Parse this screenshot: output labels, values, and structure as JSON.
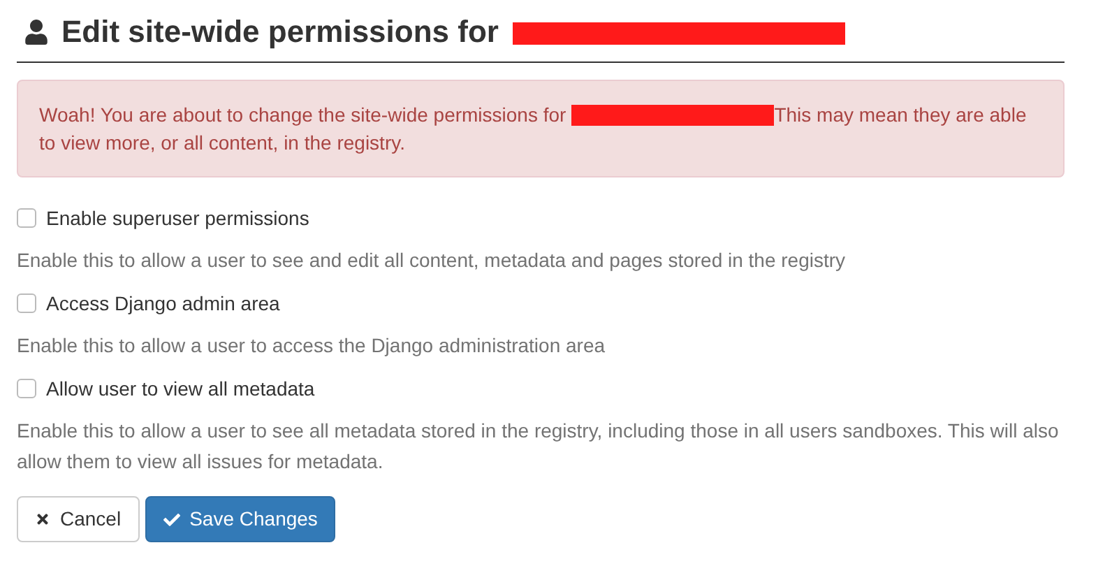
{
  "title": {
    "text": "Edit site-wide permissions for",
    "redacted": true
  },
  "alert": {
    "before": "Woah! You are about to change the site-wide permissions for",
    "after": [
      "This may mean they are able",
      "to view more, or all content, in the registry."
    ],
    "redacted": true
  },
  "options": [
    {
      "label": "Enable superuser permissions",
      "checked": false,
      "help": "Enable this to allow a user to see and edit all content, metadata and pages stored in the registry"
    },
    {
      "label": "Access Django admin area",
      "checked": false,
      "help": "Enable this to allow a user to access the Django administration area"
    },
    {
      "label": "Allow user to view all metadata",
      "checked": false,
      "help": "Enable this to allow a user to see all metadata stored in the registry, including those in all users sandboxes. This will also allow them to view all issues for metadata."
    }
  ],
  "buttons": [
    {
      "label": "Cancel",
      "kind": "default"
    },
    {
      "label": "Save Changes",
      "kind": "primary"
    }
  ]
}
